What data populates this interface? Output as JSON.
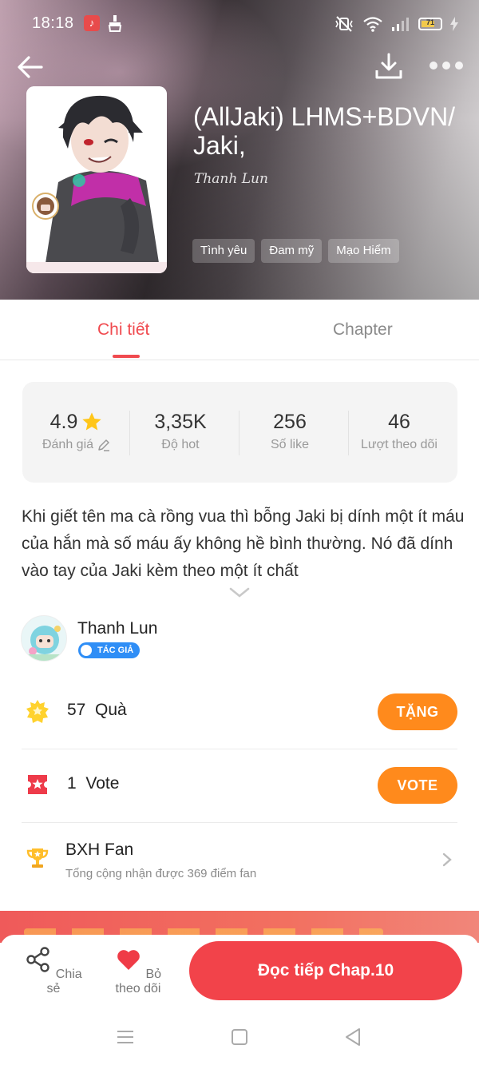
{
  "status_bar": {
    "time": "18:18",
    "battery_level": "71"
  },
  "story": {
    "title": "(AllJaki) LHMS+BDVN/ Jaki,",
    "author": "Thanh Lun",
    "tags": [
      "Tình yêu",
      "Đam mỹ",
      "Mạo Hiểm"
    ]
  },
  "tabs": {
    "detail": "Chi tiết",
    "chapter": "Chapter",
    "active": "detail"
  },
  "stats": [
    {
      "value": "4.9",
      "label": "Đánh giá"
    },
    {
      "value": "3,35K",
      "label": "Độ hot"
    },
    {
      "value": "256",
      "label": "Số like"
    },
    {
      "value": "46",
      "label": "Lượt theo dõi"
    }
  ],
  "description": "Khi giết tên ma cà rồng vua thì bỗng Jaki bị dính một ít máu của hắn mà số máu ấy không hề bình thường. Nó đã dính vào tay của Jaki kèm theo một ít chất",
  "author_card": {
    "name": "Thanh Lun",
    "badge": "TÁC GIẢ"
  },
  "gifts": {
    "count": "57",
    "label": "Quà",
    "button": "TẶNG"
  },
  "votes": {
    "count": "1",
    "label": "Vote",
    "button": "VOTE"
  },
  "fan_ranking": {
    "title": "BXH Fan",
    "subtitle": "Tổng cộng nhận được 369 điểm fan"
  },
  "bottom_bar": {
    "share": "Chia sẻ",
    "unfollow": "Bỏ theo dõi",
    "continue_reading": "Đọc tiếp Chap.10"
  },
  "colors": {
    "accent": "#f04a4f",
    "orange_button": "#ff8a1c",
    "badge_blue": "#2f8ef6"
  }
}
